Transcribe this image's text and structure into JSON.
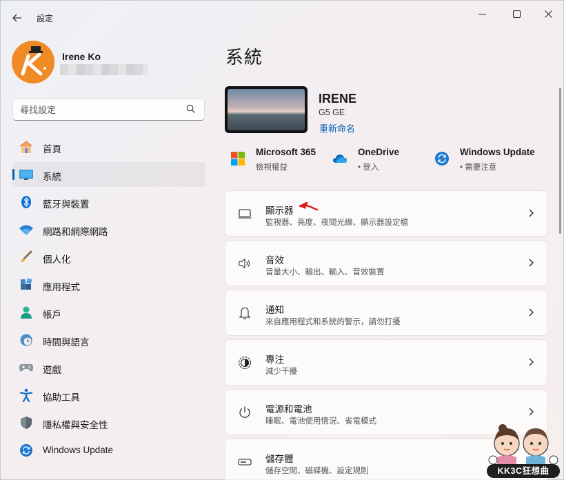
{
  "window": {
    "title": "設定",
    "back_icon": "back-arrow-icon",
    "minimize_icon": "minimize-icon",
    "maximize_icon": "maximize-icon",
    "close_icon": "close-icon"
  },
  "user": {
    "name": "Irene Ko",
    "avatar_icon": "user-avatar-logo"
  },
  "search": {
    "placeholder": "尋找設定",
    "icon": "search-icon"
  },
  "sidebar": {
    "items": [
      {
        "label": "首頁",
        "icon": "home-icon",
        "selected": false
      },
      {
        "label": "系統",
        "icon": "monitor-icon",
        "selected": true
      },
      {
        "label": "藍牙與裝置",
        "icon": "bluetooth-icon",
        "selected": false
      },
      {
        "label": "網路和網際網路",
        "icon": "wifi-icon",
        "selected": false
      },
      {
        "label": "個人化",
        "icon": "paintbrush-icon",
        "selected": false
      },
      {
        "label": "應用程式",
        "icon": "apps-icon",
        "selected": false
      },
      {
        "label": "帳戶",
        "icon": "person-icon",
        "selected": false
      },
      {
        "label": "時間與語言",
        "icon": "globe-clock-icon",
        "selected": false
      },
      {
        "label": "遊戲",
        "icon": "gamepad-icon",
        "selected": false
      },
      {
        "label": "協助工具",
        "icon": "accessibility-icon",
        "selected": false
      },
      {
        "label": "隱私權與安全性",
        "icon": "shield-icon",
        "selected": false
      },
      {
        "label": "Windows Update",
        "icon": "update-icon",
        "selected": false
      }
    ]
  },
  "main": {
    "title": "系統",
    "device": {
      "name": "IRENE",
      "model": "G5 GE",
      "rename_label": "重新命名"
    },
    "quick": [
      {
        "title": "Microsoft 365",
        "sub": "檢視權益",
        "icon": "microsoft-logo-icon"
      },
      {
        "title": "OneDrive",
        "sub": "• 登入",
        "icon": "onedrive-cloud-icon"
      },
      {
        "title": "Windows Update",
        "sub": "• 需要注意",
        "icon": "update-icon"
      }
    ],
    "cards": [
      {
        "title": "顯示器",
        "sub": "監視器、亮度、夜間光線、顯示器設定檔",
        "icon": "display-icon"
      },
      {
        "title": "音效",
        "sub": "音量大小、輸出、輸入、音效裝置",
        "icon": "speaker-icon"
      },
      {
        "title": "通知",
        "sub": "來自應用程式和系統的警示，請勿打擾",
        "icon": "bell-icon"
      },
      {
        "title": "專注",
        "sub": "減少干擾",
        "icon": "focus-icon"
      },
      {
        "title": "電源和電池",
        "sub": "睡眠、電池使用情況、省電模式",
        "icon": "power-icon"
      },
      {
        "title": "儲存體",
        "sub": "儲存空間、磁碟機、設定規則",
        "icon": "storage-drive-icon"
      }
    ]
  },
  "watermark": {
    "text": "KK3C狂想曲"
  },
  "colors": {
    "accent": "#005fb8",
    "annotation_arrow": "#e01b1b"
  }
}
